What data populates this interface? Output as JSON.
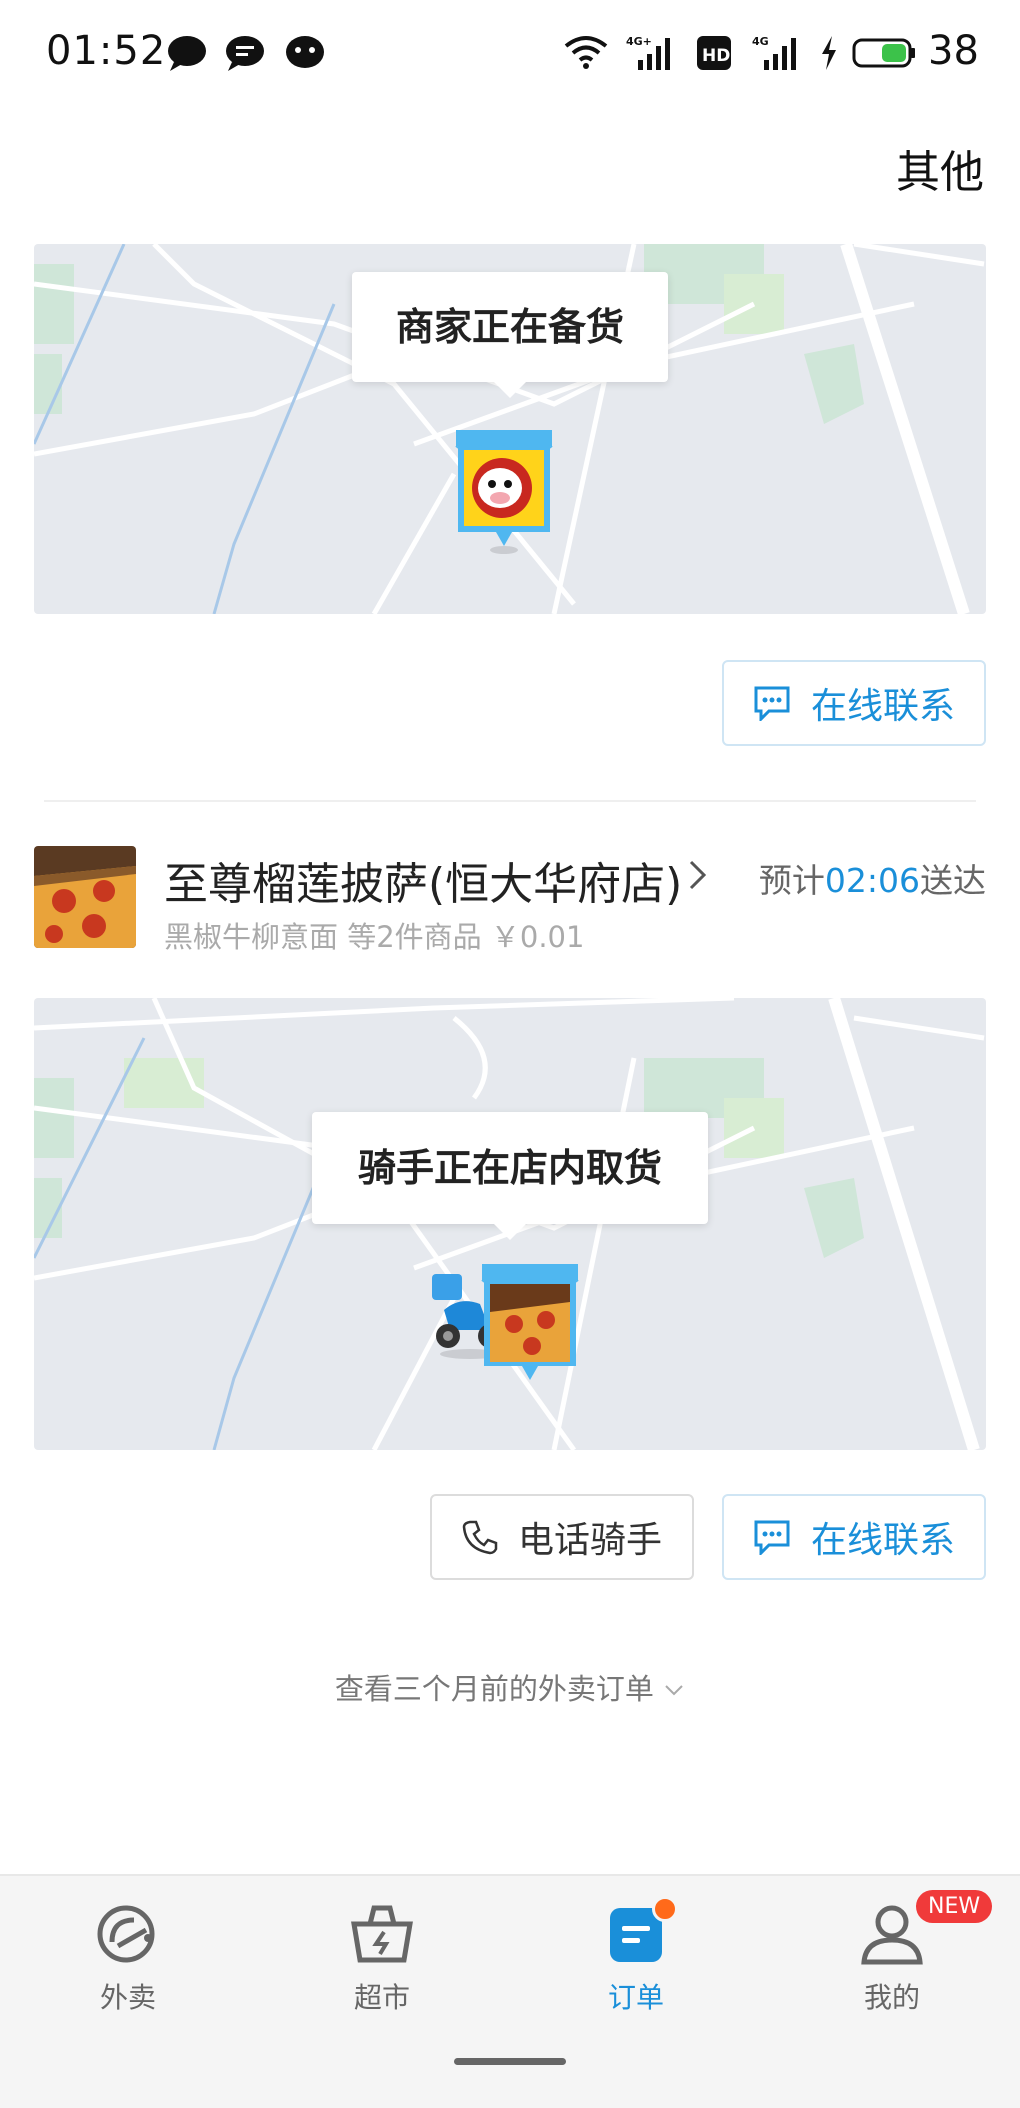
{
  "status_bar": {
    "time": "01:52",
    "battery": "38",
    "icons": [
      "message-bubble-icon",
      "chat-icon",
      "face-icon",
      "wifi-icon",
      "signal-4g-icon",
      "hd-icon",
      "signal-4g-2-icon",
      "charging-icon",
      "battery-icon"
    ]
  },
  "header": {
    "right_label": "其他"
  },
  "order1": {
    "status": "商家正在备货",
    "contact_label": "在线联系"
  },
  "order2": {
    "shop_name": "至尊榴莲披萨(恒大华府店)",
    "eta_prefix": "预计",
    "eta_time": "02:06",
    "eta_suffix": "送达",
    "items_summary": "黑椒牛柳意面 等2件商品 ￥0.01",
    "status": "骑手正在店内取货",
    "call_label": "电话骑手",
    "contact_label": "在线联系"
  },
  "history_link": "查看三个月前的外卖订单",
  "nav": {
    "items": [
      {
        "label": "外卖",
        "icon": "waimai-icon"
      },
      {
        "label": "超市",
        "icon": "basket-icon"
      },
      {
        "label": "订单",
        "icon": "order-icon"
      },
      {
        "label": "我的",
        "icon": "user-icon"
      }
    ],
    "active": "订单",
    "new_badge": "NEW"
  },
  "colors": {
    "accent": "#1a8fd9",
    "badge_orange": "#ff6a1a",
    "badge_red": "#f03a3a",
    "map_bg": "#e6e9ee"
  }
}
